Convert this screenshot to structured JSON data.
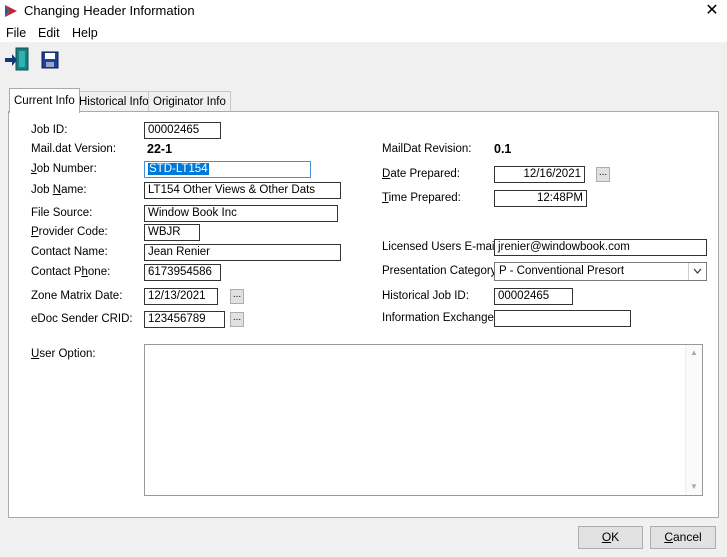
{
  "window": {
    "title": "Changing Header Information",
    "close_glyph": "✕"
  },
  "menu": {
    "file": "File",
    "edit": "Edit",
    "help": "Help"
  },
  "toolbar": {
    "exit_icon": "exit-door-icon",
    "save_icon": "floppy-disk-icon"
  },
  "tabs": [
    {
      "label": "Current Info",
      "active": true
    },
    {
      "label": "Historical Info",
      "active": false
    },
    {
      "label": "Originator Info",
      "active": false
    }
  ],
  "form": {
    "job_id_label": "Job ID:",
    "job_id_value": "00002465",
    "maildat_version_label": "Mail.dat Version:",
    "maildat_version_value": "22-1",
    "job_number_label": "Job Number:",
    "job_number_value": "STD-LT154",
    "job_name_label": "Job Name:",
    "job_name_value": "LT154 Other Views & Other Dats",
    "file_source_label": "File Source:",
    "file_source_value": "Window Book Inc",
    "provider_code_label": "Provider Code:",
    "provider_code_value": "WBJR",
    "contact_name_label": "Contact Name:",
    "contact_name_value": "Jean Renier",
    "contact_phone_label": "Contact Phone:",
    "contact_phone_value": "6173954586",
    "zone_matrix_date_label": "Zone Matrix Date:",
    "zone_matrix_date_value": "12/13/2021",
    "edoc_sender_crid_label": "eDoc Sender CRID:",
    "edoc_sender_crid_value": "123456789",
    "user_option_label": "User Option:",
    "user_option_value": "",
    "maildat_revision_label": "MailDat Revision:",
    "maildat_revision_value": "0.1",
    "date_prepared_label": "Date Prepared:",
    "date_prepared_value": "12/16/2021",
    "time_prepared_label": "Time Prepared:",
    "time_prepared_value": "12:48PM",
    "licensed_email_label": "Licensed Users E-mail:",
    "licensed_email_value": "jrenier@windowbook.com",
    "presentation_category_label": "Presentation Category:",
    "presentation_category_value": "P - Conventional Presort",
    "historical_job_id_label": "Historical Job ID:",
    "historical_job_id_value": "00002465",
    "information_exchange_label": "Information Exchange:",
    "information_exchange_value": "",
    "ellipsis": "..."
  },
  "buttons": {
    "ok": "OK",
    "cancel": "Cancel"
  }
}
